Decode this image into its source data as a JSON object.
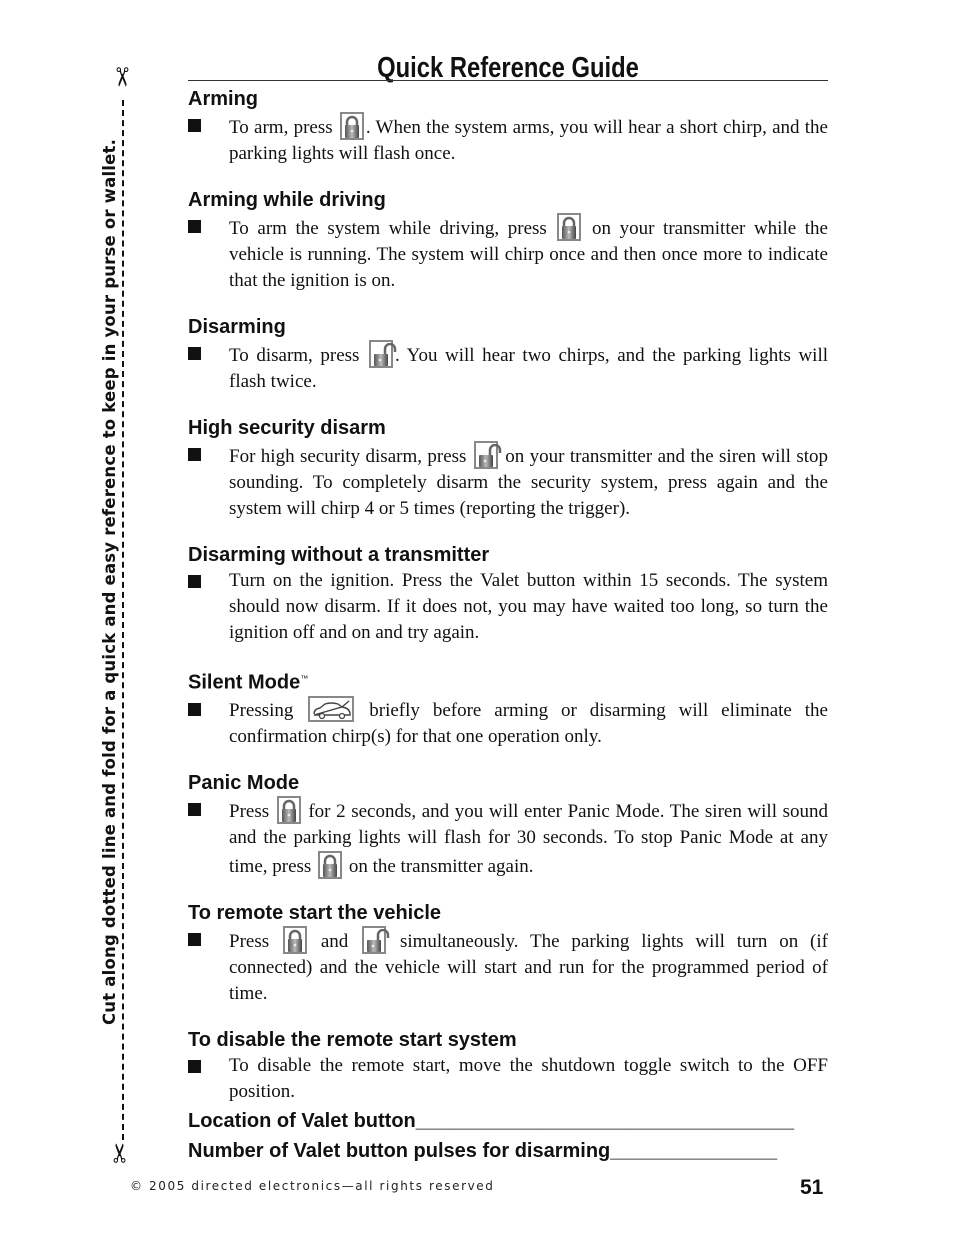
{
  "header": {
    "title": "Quick Reference Guide"
  },
  "cut_note": "Cut along dotted line and fold for a quick and easy reference to keep in your purse or wallet.",
  "sections": [
    {
      "heading": "Arming",
      "parts": [
        "To arm, press ",
        {
          "icon": "lock-closed"
        },
        ". When the system arms, you will hear a short chirp, and the parking lights will flash once."
      ]
    },
    {
      "heading": "Arming while driving",
      "parts": [
        "To arm the system while driving, press ",
        {
          "icon": "lock-closed"
        },
        " on your transmitter while the vehicle is running. The system will chirp once and then once more to indicate that the ignition is on."
      ]
    },
    {
      "heading": "Disarming",
      "parts": [
        "To disarm, press ",
        {
          "icon": "lock-open"
        },
        ". You will hear two chirps, and the parking lights will flash twice."
      ]
    },
    {
      "heading": "High security disarm",
      "parts": [
        "For high security disarm, press ",
        {
          "icon": "lock-open"
        },
        " on your transmitter and the siren will stop sounding. To completely disarm the security system, press again and the system will chirp 4 or 5 times (reporting the trigger)."
      ]
    },
    {
      "heading": "Disarming without a transmitter",
      "parts": [
        "Turn on the ignition. Press the Valet button within 15 seconds. The system should now disarm. If it does not, you may have waited too long, so turn the ignition off and on and try again."
      ]
    },
    {
      "heading": "Silent Mode",
      "trademark": "™",
      "parts": [
        "Pressing ",
        {
          "icon": "car-trunk"
        },
        " briefly before arming or disarming will eliminate the confirmation chirp(s) for that one operation only."
      ]
    },
    {
      "heading": "Panic Mode",
      "parts": [
        "Press ",
        {
          "icon": "lock-closed"
        },
        " for 2 seconds, and you will enter Panic Mode. The siren will sound and the parking lights will flash for 30 seconds. To stop Panic Mode at any time, press ",
        {
          "icon": "lock-closed"
        },
        " on the transmitter again."
      ]
    },
    {
      "heading": "To remote start the vehicle",
      "parts": [
        "Press ",
        {
          "icon": "lock-closed"
        },
        " and ",
        {
          "icon": "lock-open"
        },
        " simultaneously. The parking lights will turn on (if connected) and the vehicle will start and run for the programmed period of time."
      ]
    },
    {
      "heading": "To disable the remote start system",
      "parts": [
        "To disable the remote start, move the shutdown toggle switch to the OFF position."
      ]
    }
  ],
  "fields": [
    {
      "label": "Location of Valet button",
      "blank": "__________________________________"
    },
    {
      "label": "Number of Valet button pulses for disarming",
      "blank": "_______________"
    }
  ],
  "footer": {
    "copyright": "© 2005 directed electronics—all rights reserved",
    "page_number": "51"
  }
}
